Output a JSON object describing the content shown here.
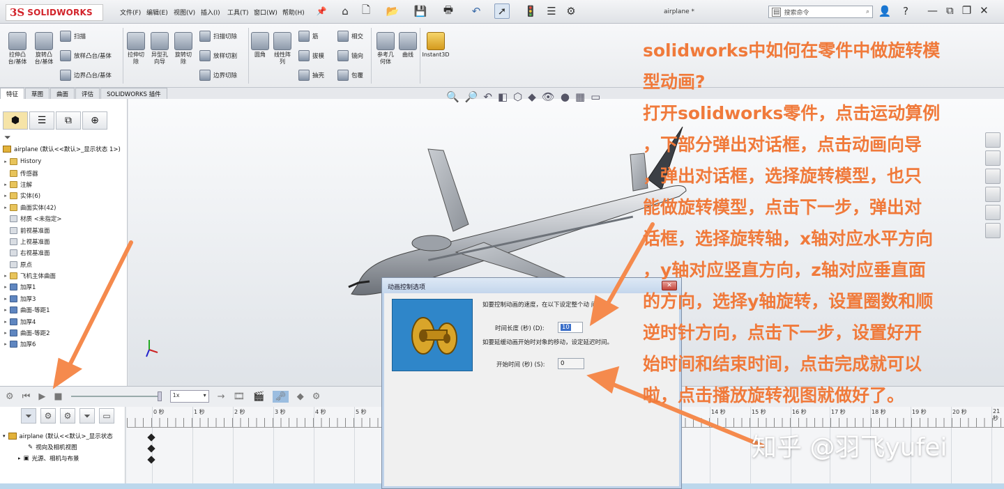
{
  "app": {
    "logo_mark": "3S",
    "logo_text": "SOLIDWORKS",
    "document_title": "airplane *",
    "menu": [
      "文件(F)",
      "编辑(E)",
      "视图(V)",
      "插入(I)",
      "工具(T)",
      "窗口(W)",
      "帮助(H)"
    ],
    "search_placeholder": "搜索命令"
  },
  "command_manager": {
    "big_buttons": [
      {
        "label": "拉伸凸\n台/基体",
        "icon": "extrude-boss-icon"
      },
      {
        "label": "旋转凸\n台/基体",
        "icon": "revolve-boss-icon"
      },
      {
        "label": "拉伸切\n除",
        "icon": "extrude-cut-icon"
      },
      {
        "label": "异型孔\n向导",
        "icon": "hole-wizard-icon"
      },
      {
        "label": "旋转切\n除",
        "icon": "revolve-cut-icon"
      },
      {
        "label": "圆角",
        "icon": "fillet-icon"
      },
      {
        "label": "线性阵\n列",
        "icon": "linear-pattern-icon"
      },
      {
        "label": "参考几\n何体",
        "icon": "reference-geometry-icon"
      },
      {
        "label": "曲线",
        "icon": "curves-icon"
      },
      {
        "label": "Instant3D",
        "icon": "instant3d-icon"
      }
    ],
    "small_buttons": {
      "sweep": "扫描",
      "loft": "放样凸台/基体",
      "boundary": "边界凸台/基体",
      "sweep_cut": "扫描切除",
      "loft_cut": "放样切割",
      "boundary_cut": "边界切除",
      "rib": "筋",
      "draft": "拔模",
      "shell": "抽壳",
      "intersect": "相交",
      "mirror": "镜向",
      "wrap": "包覆"
    }
  },
  "tabs": [
    "特征",
    "草图",
    "曲面",
    "评估",
    "SOLIDWORKS 插件"
  ],
  "feature_tree": {
    "root": "airplane  (默认<<默认>_显示状态 1>)",
    "items": [
      {
        "label": "History",
        "expand": "▸",
        "type": "f"
      },
      {
        "label": "传感器",
        "expand": "",
        "type": "f"
      },
      {
        "label": "注解",
        "expand": "▸",
        "type": "f"
      },
      {
        "label": "实体(6)",
        "expand": "▸",
        "type": "f"
      },
      {
        "label": "曲面实体(42)",
        "expand": "▸",
        "type": "f"
      },
      {
        "label": "材质 <未指定>",
        "expand": "",
        "type": "p"
      },
      {
        "label": "前视基准面",
        "expand": "",
        "type": "p"
      },
      {
        "label": "上视基准面",
        "expand": "",
        "type": "p"
      },
      {
        "label": "右视基准面",
        "expand": "",
        "type": "p"
      },
      {
        "label": "原点",
        "expand": "",
        "type": "p"
      },
      {
        "label": "飞机主体曲面",
        "expand": "▸",
        "type": "f"
      },
      {
        "label": "加厚1",
        "expand": "▸",
        "type": "b"
      },
      {
        "label": "加厚3",
        "expand": "▸",
        "type": "b"
      },
      {
        "label": "曲面-等距1",
        "expand": "▸",
        "type": "b"
      },
      {
        "label": "加厚4",
        "expand": "▸",
        "type": "b"
      },
      {
        "label": "曲面-等距2",
        "expand": "▸",
        "type": "b"
      },
      {
        "label": "加厚6",
        "expand": "▸",
        "type": "b"
      }
    ]
  },
  "motion": {
    "speed_value": "1x",
    "timeline_ticks": [
      "0 秒",
      "1 秒",
      "2 秒",
      "3 秒",
      "4 秒",
      "5 秒",
      "14 秒",
      "15 秒",
      "16 秒",
      "17 秒",
      "18 秒",
      "19 秒",
      "20 秒",
      "21 秒"
    ],
    "tree": {
      "root": "airplane  (默认<<默认>_显示状态",
      "items": [
        "视向及相机视图",
        "光源、相机与布景"
      ]
    }
  },
  "dialog": {
    "title": "动画控制选项",
    "instruction1": "如要控制动画的速度，在以下设定整个动   间长度。",
    "duration_label": "时间长度 (秒) (D):",
    "duration_value": "10",
    "instruction2": "如要延缓动画开始时对象的移动，设定延迟时间。",
    "start_label": "开始时间 (秒) (S):",
    "start_value": "0"
  },
  "overlay": {
    "lines": [
      "solidworks中如何在零件中做旋转模",
      "型动画?",
      "打开solidworks零件，点击运动算例",
      "，下部分弹出对话框，点击动画向导",
      "，弹出对话框，选择旋转模型，也只",
      "能做旋转模型，点击下一步，弹出对",
      "话框，选择旋转轴，x轴对应水平方向",
      "，y轴对应竖直方向，z轴对应垂直面",
      "的方向，选择y轴旋转，设置圈数和顺",
      "逆时针方向，点击下一步，设置好开",
      "始时间和结束时间，点击完成就可以",
      "啦，点击播放旋转视图就做好了。"
    ],
    "color": "#f07a3b"
  },
  "watermark": "知乎 @羽飞yufei"
}
